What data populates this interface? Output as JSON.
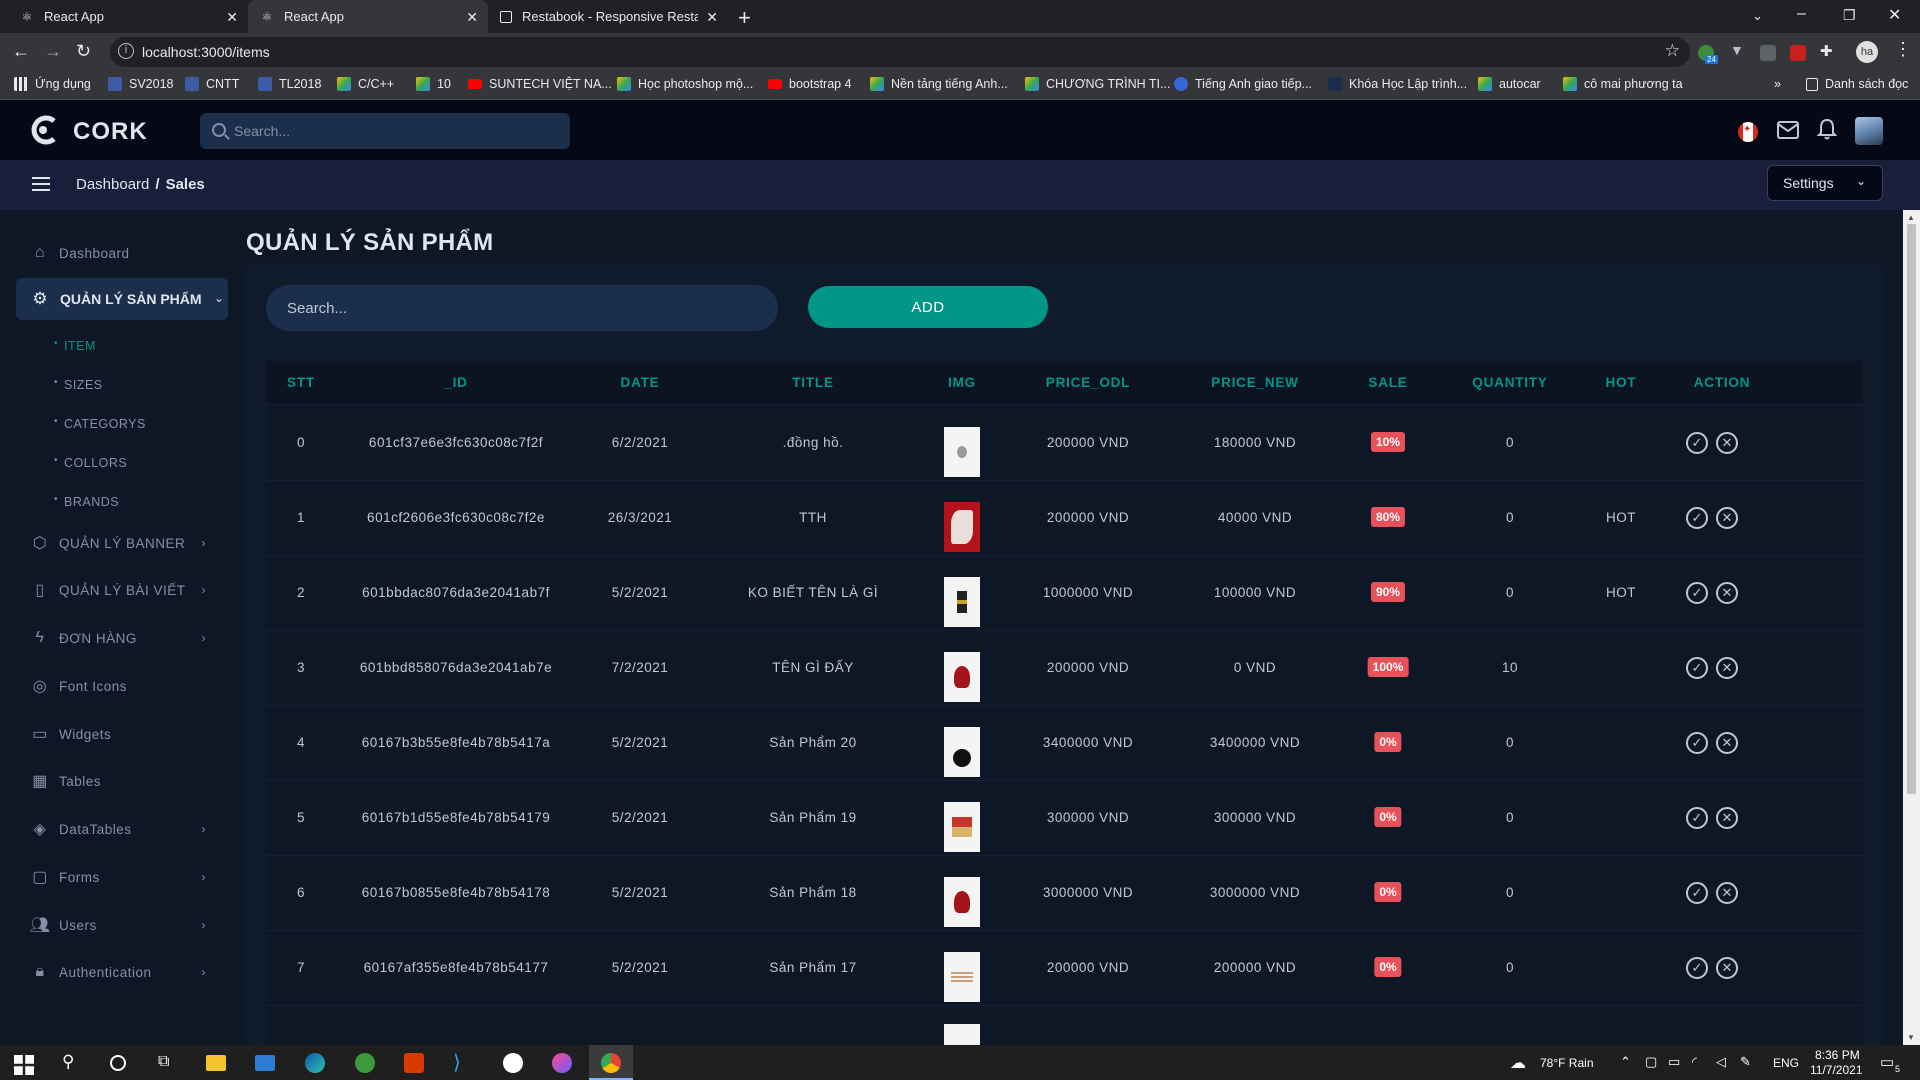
{
  "browser": {
    "tabs": [
      {
        "title": "React App"
      },
      {
        "title": "React App"
      },
      {
        "title": "Restabook - Responsive Restaurant"
      }
    ],
    "url": "localhost:3000/items",
    "bookmarks": [
      "Ứng dụng",
      "SV2018",
      "CNTT",
      "TL2018",
      "C/C++",
      "10",
      "SUNTECH VIỆT NA...",
      "Học photoshop mộ...",
      "bootstrap 4",
      "Nền tảng tiếng Anh...",
      "CHƯƠNG TRÌNH TI...",
      "Tiếng Anh giao tiếp...",
      "Khóa Học Lập trình...",
      "autocar",
      "cô mai phương ta"
    ],
    "bookmarks_other": "Danh sách đọc",
    "profile_initials": "ha",
    "ext_badge": "24"
  },
  "header": {
    "brand": "CORK",
    "search_placeholder": "Search..."
  },
  "subheader": {
    "crumb_root": "Dashboard",
    "crumb_sep": "/",
    "crumb_current": "Sales",
    "settings_label": "Settings"
  },
  "sidebar": {
    "dashboard": "Dashboard",
    "active_group": "QUẢN LÝ SẢN PHẨM",
    "submenu": [
      "ITEM",
      "SIZES",
      "CATEGORYS",
      "COLLORS",
      "BRANDS"
    ],
    "items": [
      "QUẢN LÝ BANNER",
      "QUẢN LÝ BÀI VIẾT",
      "ĐƠN HÀNG",
      "Font Icons",
      "Widgets",
      "Tables",
      "DataTables",
      "Forms",
      "Users",
      "Authentication"
    ]
  },
  "main": {
    "title": "QUẢN LÝ SẢN PHẨM",
    "search_placeholder": "Search...",
    "add_label": "ADD",
    "columns": [
      "STT",
      "_ID",
      "DATE",
      "TITLE",
      "IMG",
      "PRICE_ODL",
      "PRICE_NEW",
      "SALE",
      "QUANTITY",
      "HOT",
      "ACTION"
    ],
    "rows": [
      {
        "stt": "0",
        "id": "601cf37e6e3fc630c08c7f2f",
        "date": "6/2/2021",
        "title": ".đồng hồ.",
        "price_old": "200000 VND",
        "price_new": "180000 VND",
        "sale": "10%",
        "quantity": "0",
        "hot": ""
      },
      {
        "stt": "1",
        "id": "601cf2606e3fc630c08c7f2e",
        "date": "26/3/2021",
        "title": "TTH",
        "price_old": "200000 VND",
        "price_new": "40000 VND",
        "sale": "80%",
        "quantity": "0",
        "hot": "HOT"
      },
      {
        "stt": "2",
        "id": "601bbdac8076da3e2041ab7f",
        "date": "5/2/2021",
        "title": "KO BIẾT TÊN LÀ GÌ",
        "price_old": "1000000 VND",
        "price_new": "100000 VND",
        "sale": "90%",
        "quantity": "0",
        "hot": "HOT"
      },
      {
        "stt": "3",
        "id": "601bbd858076da3e2041ab7e",
        "date": "7/2/2021",
        "title": "TÊN GÌ ĐẤY",
        "price_old": "200000 VND",
        "price_new": "0 VND",
        "sale": "100%",
        "quantity": "10",
        "hot": ""
      },
      {
        "stt": "4",
        "id": "60167b3b55e8fe4b78b5417a",
        "date": "5/2/2021",
        "title": "Sản Phẩm 20",
        "price_old": "3400000 VND",
        "price_new": "3400000 VND",
        "sale": "0%",
        "quantity": "0",
        "hot": ""
      },
      {
        "stt": "5",
        "id": "60167b1d55e8fe4b78b54179",
        "date": "5/2/2021",
        "title": "Sản Phẩm 19",
        "price_old": "300000 VND",
        "price_new": "300000 VND",
        "sale": "0%",
        "quantity": "0",
        "hot": ""
      },
      {
        "stt": "6",
        "id": "60167b0855e8fe4b78b54178",
        "date": "5/2/2021",
        "title": "Sản Phẩm 18",
        "price_old": "3000000 VND",
        "price_new": "3000000 VND",
        "sale": "0%",
        "quantity": "0",
        "hot": ""
      },
      {
        "stt": "7",
        "id": "60167af355e8fe4b78b54177",
        "date": "5/2/2021",
        "title": "Sản Phẩm 17",
        "price_old": "200000 VND",
        "price_new": "200000 VND",
        "sale": "0%",
        "quantity": "0",
        "hot": ""
      }
    ]
  },
  "taskbar": {
    "weather": "78°F  Rain",
    "lang": "ENG",
    "time": "8:36 PM",
    "date": "11/7/2021",
    "notif_count": "5"
  },
  "colors": {
    "accent": "#009688",
    "badge": "#e7515a",
    "bg": "#0e1726",
    "header": "#060818"
  }
}
